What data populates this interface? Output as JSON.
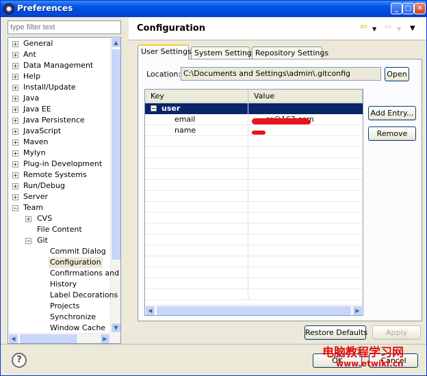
{
  "window": {
    "title": "Preferences",
    "minimize": "_",
    "maximize": "□",
    "close": "✕"
  },
  "left": {
    "filter_placeholder": "type filter text",
    "tree": [
      {
        "label": "General",
        "expander": "+"
      },
      {
        "label": "Ant",
        "expander": "+"
      },
      {
        "label": "Data Management",
        "expander": "+"
      },
      {
        "label": "Help",
        "expander": "+"
      },
      {
        "label": "Install/Update",
        "expander": "+"
      },
      {
        "label": "Java",
        "expander": "+"
      },
      {
        "label": "Java EE",
        "expander": "+"
      },
      {
        "label": "Java Persistence",
        "expander": "+"
      },
      {
        "label": "JavaScript",
        "expander": "+"
      },
      {
        "label": "Maven",
        "expander": "+"
      },
      {
        "label": "Mylyn",
        "expander": "+"
      },
      {
        "label": "Plug-in Development",
        "expander": "+"
      },
      {
        "label": "Remote Systems",
        "expander": "+"
      },
      {
        "label": "Run/Debug",
        "expander": "+"
      },
      {
        "label": "Server",
        "expander": "+"
      },
      {
        "label": "Team",
        "expander": "−"
      },
      {
        "label": "CVS",
        "expander": "+"
      },
      {
        "label": "File Content",
        "expander": ""
      },
      {
        "label": "Git",
        "expander": "−"
      },
      {
        "label": "Commit Dialog",
        "expander": ""
      },
      {
        "label": "Configuration",
        "expander": ""
      },
      {
        "label": "Confirmations and",
        "expander": ""
      },
      {
        "label": "History",
        "expander": ""
      },
      {
        "label": "Label Decorations",
        "expander": ""
      },
      {
        "label": "Projects",
        "expander": ""
      },
      {
        "label": "Synchronize",
        "expander": ""
      },
      {
        "label": "Window Cache",
        "expander": ""
      }
    ]
  },
  "right": {
    "heading": "Configuration",
    "back_icon": "⇦",
    "forward_icon": "⇨",
    "menu_icon": "▼",
    "tabs": [
      "User Settings",
      "System Settings",
      "Repository Settings"
    ],
    "location_label": "Location:",
    "location_value": "C:\\Documents and Settings\\admin\\.gitconfig",
    "open_button": "Open",
    "add_entry_button": "Add Entry...",
    "remove_button": "Remove",
    "columns": {
      "key": "Key",
      "value": "Value"
    },
    "rows": [
      {
        "key": "user",
        "value": "",
        "expander": "−"
      },
      {
        "key": "email",
        "value": "..._cs@163.com",
        "expander": ""
      },
      {
        "key": "name",
        "value": "",
        "expander": ""
      }
    ],
    "restore_defaults": "Restore Defaults",
    "apply": "Apply"
  },
  "footer": {
    "help": "?",
    "ok": "OK",
    "cancel": "Cancel",
    "watermark_title": "电脑教程学习网",
    "watermark_url": "www.etwiki.cn"
  },
  "colors": {
    "titlebar": "#0054e3",
    "selection": "#0a246a",
    "tab_highlight": "#ffc83c",
    "redaction": "#e8141a"
  }
}
